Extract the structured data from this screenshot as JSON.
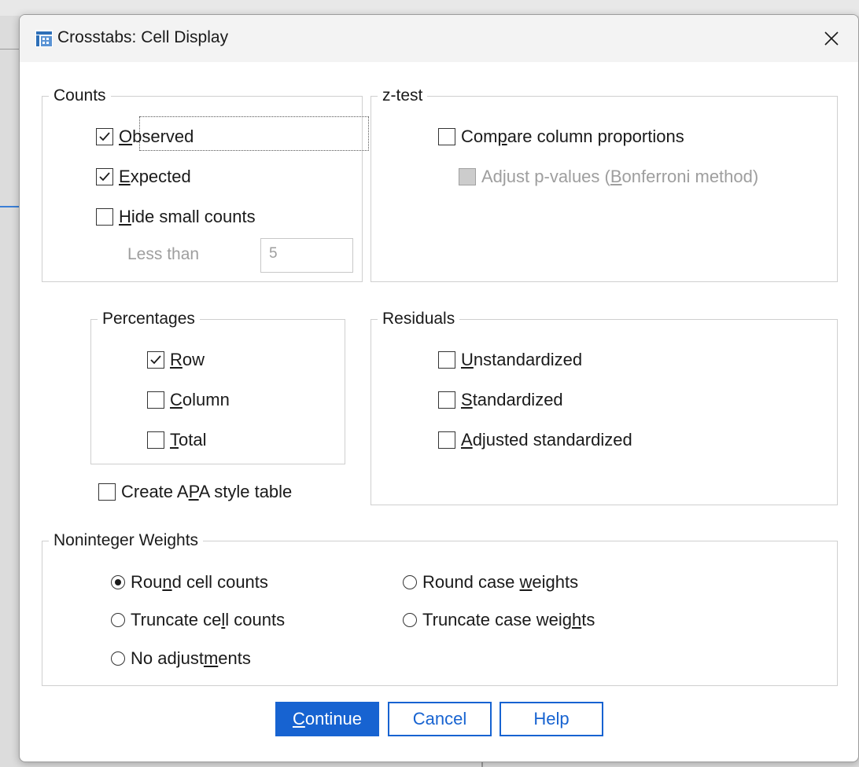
{
  "window": {
    "title": "Crosstabs: Cell Display"
  },
  "counts": {
    "legend": "Counts",
    "observed": {
      "pre": "",
      "key": "O",
      "post": "bserved",
      "checked": true
    },
    "expected": {
      "pre": "",
      "key": "E",
      "post": "xpected",
      "checked": true
    },
    "hide_small": {
      "pre": "",
      "key": "H",
      "post": "ide small counts",
      "checked": false
    },
    "less_than_label": "Less than",
    "less_than_value": "5"
  },
  "ztest": {
    "legend": "z-test",
    "compare": {
      "pre": "Com",
      "key": "p",
      "post": "are column proportions",
      "checked": false
    },
    "adjust": {
      "pre": "Adjust p-values (",
      "key": "B",
      "post": "onferroni method)",
      "checked": false,
      "disabled": true
    }
  },
  "percentages": {
    "legend": "Percentages",
    "row": {
      "pre": "",
      "key": "R",
      "post": "ow",
      "checked": true
    },
    "column": {
      "pre": "",
      "key": "C",
      "post": "olumn",
      "checked": false
    },
    "total": {
      "pre": "",
      "key": "T",
      "post": "otal",
      "checked": false
    }
  },
  "apa": {
    "pre": "Create A",
    "key": "P",
    "post": "A style table",
    "checked": false
  },
  "residuals": {
    "legend": "Residuals",
    "unstandardized": {
      "pre": "",
      "key": "U",
      "post": "nstandardized",
      "checked": false
    },
    "standardized": {
      "pre": "",
      "key": "S",
      "post": "tandardized",
      "checked": false
    },
    "adjusted": {
      "pre": "",
      "key": "A",
      "post": "djusted standardized",
      "checked": false
    }
  },
  "weights": {
    "legend": "Noninteger Weights",
    "round_cell": {
      "pre": "Rou",
      "key": "n",
      "post": "d cell counts",
      "selected": true
    },
    "truncate_cell": {
      "pre": "Truncate ce",
      "key": "l",
      "post": "l counts",
      "selected": false
    },
    "no_adjust": {
      "pre": "No adjust",
      "key": "m",
      "post": "ents",
      "selected": false
    },
    "round_case": {
      "pre": "Round case ",
      "key": "w",
      "post": "eights",
      "selected": false
    },
    "truncate_case": {
      "pre": "Truncate case weig",
      "key": "h",
      "post": "ts",
      "selected": false
    }
  },
  "buttons": {
    "continue": {
      "pre": "",
      "key": "C",
      "post": "ontinue"
    },
    "cancel": "Cancel",
    "help": "Help"
  },
  "colors": {
    "accent": "#1763d1",
    "disabled_text": "#9e9e9e",
    "border": "#cfcfcf"
  }
}
